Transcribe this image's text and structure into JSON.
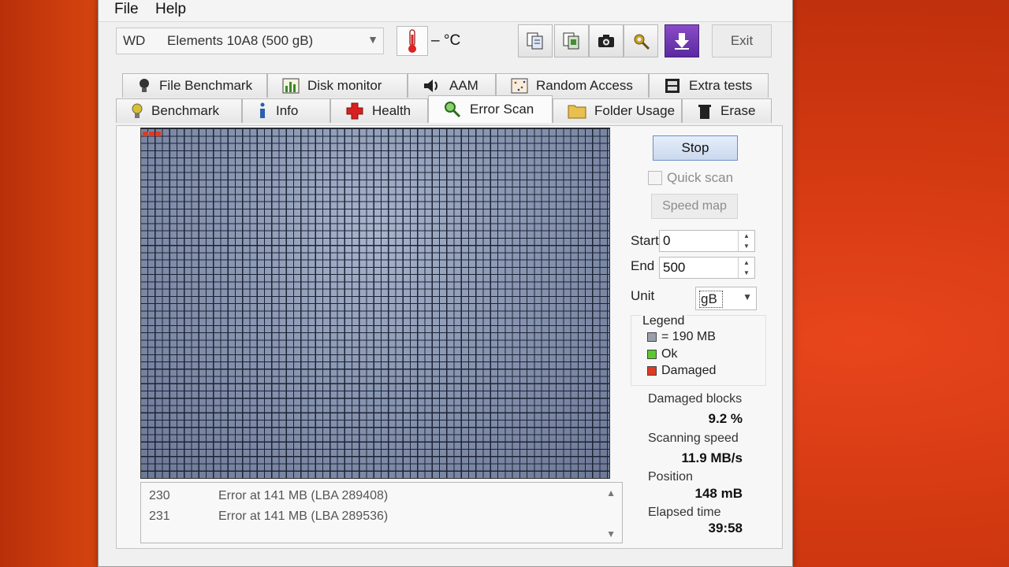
{
  "menu": {
    "file": "File",
    "help": "Help"
  },
  "toolbar": {
    "drive_vendor": "WD",
    "drive_model": "Elements 10A8 (500 gB)",
    "temperature": "– °C",
    "exit_label": "Exit"
  },
  "tabs": {
    "row1": [
      "File Benchmark",
      "Disk monitor",
      "AAM",
      "Random Access",
      "Extra tests"
    ],
    "row2": [
      "Benchmark",
      "Info",
      "Health",
      "Error Scan",
      "Folder Usage",
      "Erase"
    ],
    "active": "Error Scan"
  },
  "scan": {
    "stop_label": "Stop",
    "quick_scan_label": "Quick scan",
    "quick_scan_checked": false,
    "speed_map_label": "Speed map",
    "start_label": "Start",
    "start_value": "0",
    "end_label": "End",
    "end_value": "500",
    "unit_label": "Unit",
    "unit_value": "gB"
  },
  "legend": {
    "title": "Legend",
    "block_size": "= 190 MB",
    "ok": "Ok",
    "damaged": "Damaged",
    "colors": {
      "block": "#9aa0aa",
      "ok": "#5cc830",
      "damaged": "#e03a22"
    }
  },
  "stats": {
    "damaged_blocks_label": "Damaged blocks",
    "damaged_blocks_value": "9.2 %",
    "scanning_speed_label": "Scanning speed",
    "scanning_speed_value": "11.9 MB/s",
    "position_label": "Position",
    "position_value": "148 mB",
    "elapsed_label": "Elapsed time",
    "elapsed_value": "39:58"
  },
  "log": [
    {
      "num": "230",
      "msg": "Error at 141 MB (LBA 289408)"
    },
    {
      "num": "231",
      "msg": "Error at 141 MB (LBA 289536)"
    }
  ],
  "damaged_block_count": 3
}
